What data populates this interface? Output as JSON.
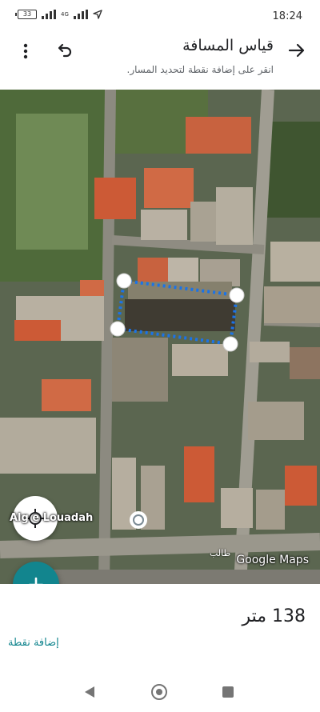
{
  "status_bar": {
    "battery": "33",
    "network": "4G",
    "time": "18:24"
  },
  "header": {
    "title": "قياس المسافة",
    "subtitle": "انقر على إضافة نقطة لتحديد المسار.",
    "icons": [
      "arrow-forward-icon",
      "undo-icon",
      "more-vert-icon"
    ]
  },
  "map": {
    "place_label": "Alg     e Louadah",
    "watermark": "Google Maps",
    "road_label": "طالب",
    "measured_path_points": 4
  },
  "bottom": {
    "distance": "138 متر",
    "add_point": "إضافة نقطة"
  },
  "colors": {
    "accent": "#12858e",
    "measure_line": "#1a73e8"
  }
}
